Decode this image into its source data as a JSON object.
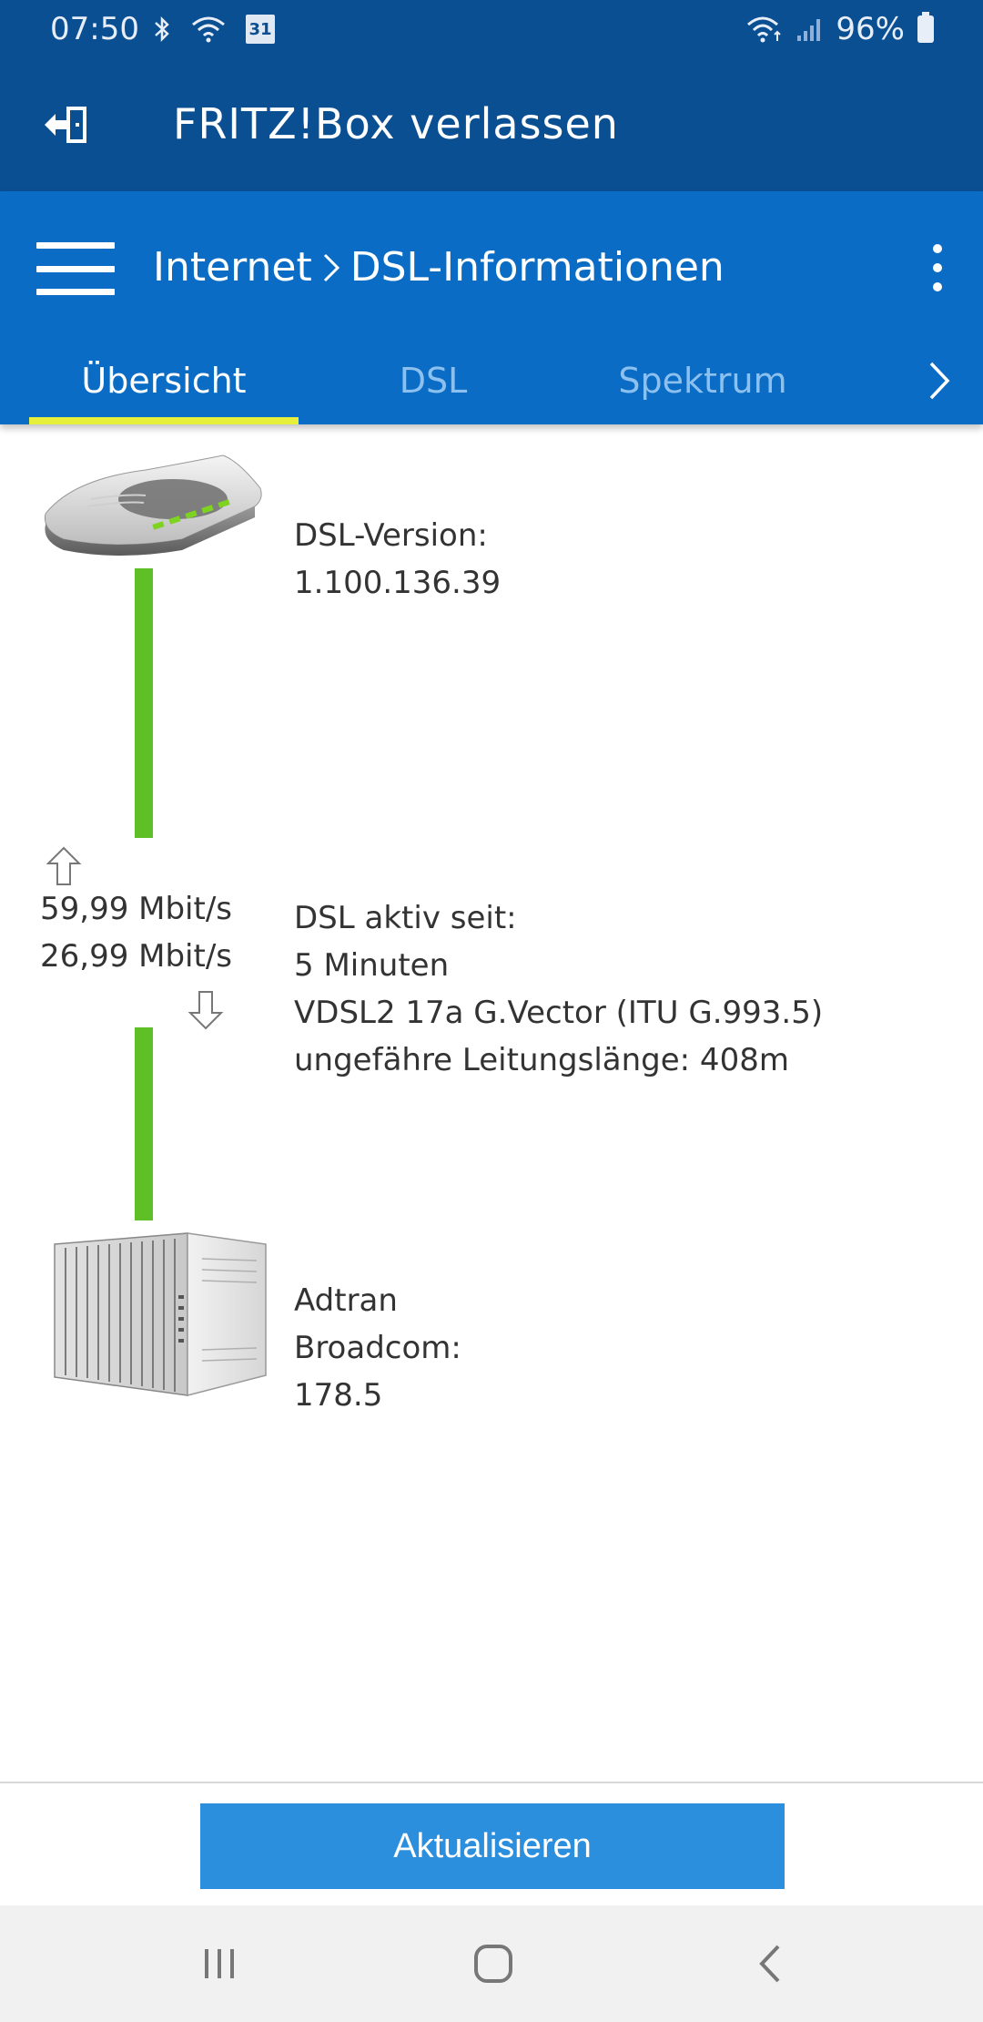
{
  "status_bar": {
    "time": "07:50",
    "calendar_day": "31",
    "battery": "96%"
  },
  "fritz_header": {
    "title": "FRITZ!Box verlassen"
  },
  "app_bar": {
    "breadcrumb_parent": "Internet",
    "breadcrumb_current": "DSL-Informationen"
  },
  "tabs": [
    {
      "label": "Übersicht",
      "active": true
    },
    {
      "label": "DSL",
      "active": false
    },
    {
      "label": "Spektrum",
      "active": false
    }
  ],
  "overview": {
    "router": {
      "line1": "DSL-Version:",
      "line2": "1.100.136.39"
    },
    "speeds": {
      "upstream": "59,99 Mbit/s",
      "downstream": "26,99 Mbit/s"
    },
    "connection": {
      "line1": "DSL aktiv seit:",
      "line2": "5 Minuten",
      "line3": "VDSL2 17a G.Vector (ITU G.993.5)",
      "line4": "ungefähre Leitungslänge: 408m"
    },
    "dslam": {
      "line1": "Adtran",
      "line2": "Broadcom:",
      "line3": "178.5"
    }
  },
  "actions": {
    "update_label": "Aktualisieren"
  },
  "colors": {
    "header_dark": "#0b4f93",
    "app_bar": "#0a6cc4",
    "tab_indicator": "#e6ef3c",
    "line_green": "#5fbf26",
    "button_blue": "#2c8fde"
  }
}
